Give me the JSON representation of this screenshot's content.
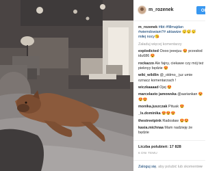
{
  "post": {
    "username": "m_rozenek",
    "follow_label": "Ob",
    "caption_user": "m_rozenek",
    "caption_text": "#tbt #fillmajdan #wiemdowiam?#",
    "caption_text2": "aktawize 😴😴😴 miłej nocy😘",
    "load_more": "Załaduj więcej komentarzy",
    "comments": [
      {
        "user": "explodicted",
        "text": "Oooo jeeejuu 😍 przesłod"
      },
      {
        "user": "",
        "text": "idu686 😍"
      },
      {
        "user": "rockazzo",
        "text": "Ale fajny, ciekawe czy mój też pieknyy będzie 😍"
      },
      {
        "user": "wiki_wildlin",
        "text": "@_oldmo_ juz umie oznacz komentarzach !"
      },
      {
        "user": "wiczkaaaad",
        "text": "Ojej 😍"
      },
      {
        "user": "marcelasto jamowska",
        "text": "@aariankan 😍😍😍"
      },
      {
        "user": "monika.juszczak",
        "text": "Pituak 😍"
      },
      {
        "user": "_ls.dominika",
        "text": "😍😍😍"
      },
      {
        "user": "thestreetpink",
        "text": "Radosław 😍😍"
      },
      {
        "user": "kasia.michnaa",
        "text": "Mam nadzieję że będzie"
      }
    ],
    "likes": "Liczba polubień: 17 828",
    "date": "6 DNI TEMU",
    "login_prefix": "Zaloguj się",
    "login_suffix": ", aby polubić lub skomentow",
    "more_label": "···"
  },
  "colors": {
    "accent": "#3897f0",
    "link": "#003569",
    "muted": "#999999"
  }
}
